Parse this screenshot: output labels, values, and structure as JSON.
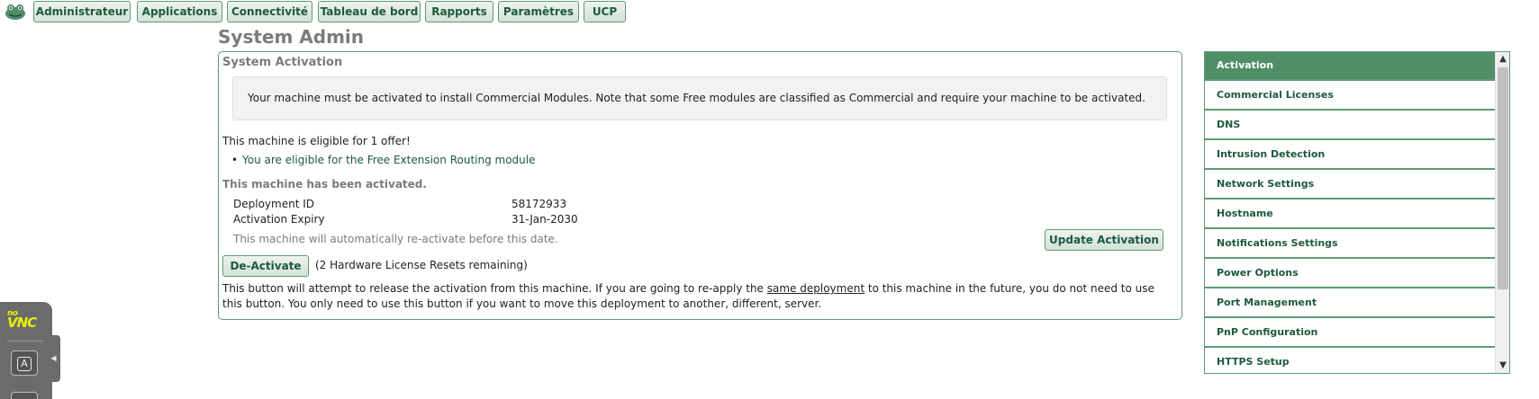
{
  "nav": {
    "logo": "frog-logo-icon",
    "items": [
      {
        "label": "Administrateur"
      },
      {
        "label": "Applications"
      },
      {
        "label": "Connectivité"
      },
      {
        "label": "Tableau de bord"
      },
      {
        "label": "Rapports"
      },
      {
        "label": "Paramètres"
      },
      {
        "label": "UCP"
      }
    ]
  },
  "page": {
    "title": "System Admin"
  },
  "activation": {
    "section_title": "System Activation",
    "notice": "Your machine must be activated to install Commercial Modules. Note that some Free modules are classified as Commercial and require your machine to be activated.",
    "eligible_text": "This machine is eligible for 1 offer!",
    "offer_link": "You are eligible for the Free Extension Routing module",
    "activated_text": "This machine has been activated.",
    "deployment_id_label": "Deployment ID",
    "deployment_id_value": "58172933",
    "expiry_label": "Activation Expiry",
    "expiry_value": "31-Jan-2030",
    "auto_reactivate_text": "This machine will automatically re-activate before this date.",
    "update_button": "Update Activation",
    "deactivate_button": "De-Activate",
    "resets_text": "(2 Hardware License Resets remaining)",
    "release_text_before": "This button will attempt to release the activation from this machine. If you are going to re-apply the ",
    "release_text_link": "same deployment",
    "release_text_after": " to this machine in the future, you do not need to use this button. You only need to use this button if you want to move this deployment to another, different, server."
  },
  "side_menu": {
    "items": [
      {
        "label": "Activation",
        "active": true
      },
      {
        "label": "Commercial Licenses"
      },
      {
        "label": "DNS"
      },
      {
        "label": "Intrusion Detection"
      },
      {
        "label": "Network Settings"
      },
      {
        "label": "Hostname"
      },
      {
        "label": "Notifications Settings"
      },
      {
        "label": "Power Options"
      },
      {
        "label": "Port Management"
      },
      {
        "label": "PnP Configuration"
      },
      {
        "label": "HTTPS Setup"
      }
    ]
  },
  "vnc": {
    "logo_top": "no",
    "logo_bottom": "VNC",
    "key_label": "A"
  },
  "colors": {
    "accent": "#4f8f68",
    "border": "#5f9a78",
    "text_green": "#1e5a3c",
    "muted": "#7b7b7b"
  }
}
